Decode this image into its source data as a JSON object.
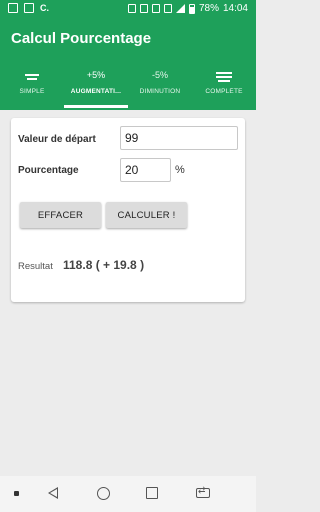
{
  "status_bar": {
    "battery": "78%",
    "time": "14:04"
  },
  "app": {
    "title": "Calcul Pourcentage",
    "accent_color": "#1ea05a"
  },
  "tabs": [
    {
      "label": "SIMPLE",
      "icon": "bars-icon",
      "active": false
    },
    {
      "label": "AUGMENTATI...",
      "icon_text": "+5%",
      "active": true
    },
    {
      "label": "DIMINUTION",
      "icon_text": "-5%",
      "active": false
    },
    {
      "label": "COMPLÈTE",
      "icon": "list-icon",
      "active": false
    }
  ],
  "form": {
    "start_label": "Valeur de départ",
    "start_value": "99",
    "percent_label": "Pourcentage",
    "percent_value": "20",
    "percent_unit": "%",
    "clear_button": "EFFACER",
    "calc_button": "CALCULER !",
    "result_label": "Resultat",
    "result_value": "118.8 ( + 19.8 )"
  }
}
